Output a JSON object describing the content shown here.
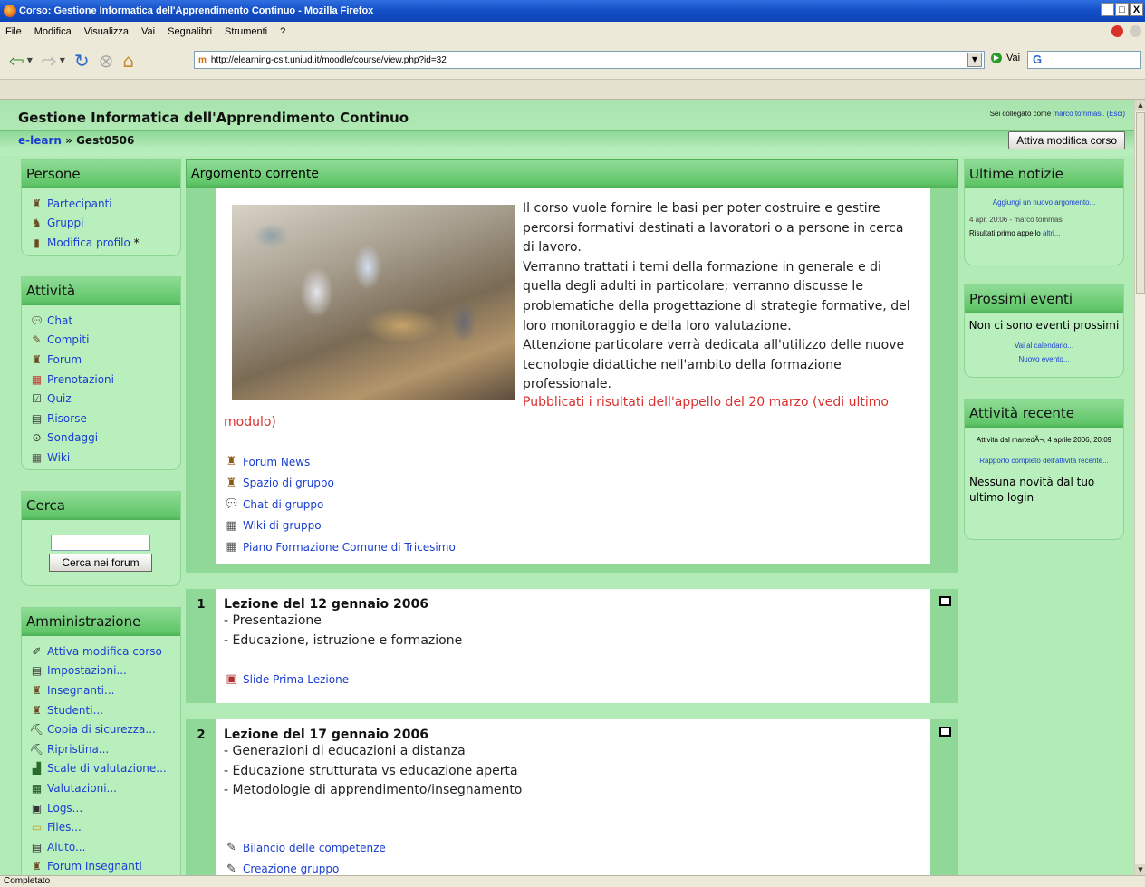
{
  "window": {
    "title": "Corso: Gestione Informatica dell'Apprendimento Continuo - Mozilla Firefox",
    "buttons": [
      "_",
      "□",
      "X"
    ]
  },
  "menu": [
    "File",
    "Modifica",
    "Visualizza",
    "Vai",
    "Segnalibri",
    "Strumenti",
    "?"
  ],
  "nav": {
    "url": "http://elearning-csit.uniud.it/moodle/course/view.php?id=32",
    "go_label": "Vai",
    "search_value": "G"
  },
  "status": "Completato",
  "page": {
    "course_title": "Gestione Informatica dell'Apprendimento Continuo",
    "login": {
      "prefix": "Sei collegato come",
      "user": "marco tommasi.",
      "logout": "(Esci)"
    },
    "breadcrumb": {
      "root": "e-learn",
      "sep": "»",
      "current": "Gest0506"
    },
    "edit_button": "Attiva modifica corso"
  },
  "persone": {
    "title": "Persone",
    "items": [
      {
        "label": "Partecipanti",
        "icon": "people-icon"
      },
      {
        "label": "Gruppi",
        "icon": "groups-icon"
      },
      {
        "label": "Modifica profilo",
        "suffix": "*",
        "icon": "profile-icon"
      }
    ]
  },
  "attivita": {
    "title": "Attività",
    "items": [
      {
        "label": "Chat",
        "icon": "chat-icon"
      },
      {
        "label": "Compiti",
        "icon": "assignment-icon"
      },
      {
        "label": "Forum",
        "icon": "forum-icon"
      },
      {
        "label": "Prenotazioni",
        "icon": "booking-icon"
      },
      {
        "label": "Quiz",
        "icon": "quiz-icon"
      },
      {
        "label": "Risorse",
        "icon": "resource-icon"
      },
      {
        "label": "Sondaggi",
        "icon": "survey-icon"
      },
      {
        "label": "Wiki",
        "icon": "wiki-icon"
      }
    ]
  },
  "cerca": {
    "title": "Cerca",
    "input_value": "",
    "button": "Cerca nei forum"
  },
  "amministrazione": {
    "title": "Amministrazione",
    "items": [
      {
        "label": "Attiva modifica corso",
        "icon": "edit-icon"
      },
      {
        "label": "Impostazioni...",
        "icon": "settings-icon"
      },
      {
        "label": "Insegnanti...",
        "icon": "teachers-icon"
      },
      {
        "label": "Studenti...",
        "icon": "students-icon"
      },
      {
        "label": "Copia di sicurezza...",
        "icon": "backup-icon"
      },
      {
        "label": "Ripristina...",
        "icon": "restore-icon"
      },
      {
        "label": "Scale di valutazione...",
        "icon": "scales-icon"
      },
      {
        "label": "Valutazioni...",
        "icon": "grades-icon"
      },
      {
        "label": "Logs...",
        "icon": "logs-icon"
      },
      {
        "label": "Files...",
        "icon": "folder-icon"
      },
      {
        "label": "Aiuto...",
        "icon": "help-icon"
      },
      {
        "label": "Forum Insegnanti",
        "icon": "forum-icon"
      }
    ]
  },
  "center": {
    "title": "Argomento corrente",
    "intro": "Il corso vuole fornire le basi per poter costruire e gestire percorsi formativi destinati a lavoratori o a persone in cerca di lavoro. Verranno trattati i temi della formazione in generale e di quella degli adulti in particolare; verranno discusse le problematiche della progettazione di strategie formative, del loro monitoraggio e della loro valutazione. Attenzione particolare verrà dedicata all'utilizzo delle nuove tecnologie didattiche nell'ambito della formazione professionale.",
    "intro_lines": [
      "Il corso vuole fornire le basi per poter costruire e gestire",
      "percorsi formativi destinati a lavoratori o a persone in cerca",
      "di lavoro.",
      "Verranno trattati i temi della formazione in generale e di",
      "quella degli adulti in particolare; verranno discusse le",
      "problematiche della progettazione di strategie formative, del",
      "loro monitoraggio e della loro valutazione.",
      "Attenzione particolare verrà dedicata all'utilizzo delle nuove",
      "tecnologie didattiche nell'ambito della formazione",
      "professionale."
    ],
    "news": "Pubblicati i risultati dell'appello del 20 marzo (vedi ultimo modulo)",
    "resources": [
      {
        "label": "Forum News",
        "icon": "forum-icon"
      },
      {
        "label": "Spazio di gruppo",
        "icon": "forum-icon"
      },
      {
        "label": "Chat di gruppo",
        "icon": "chat-icon"
      },
      {
        "label": "Wiki di gruppo",
        "icon": "wiki-icon"
      },
      {
        "label": "Piano Formazione Comune di Tricesimo",
        "icon": "wiki-icon"
      }
    ]
  },
  "sections": [
    {
      "num": "1",
      "title": "Lezione del 12 gennaio 2006",
      "lines": [
        "- Presentazione",
        "- Educazione, istruzione e formazione"
      ],
      "resources": [
        {
          "label": "Slide Prima Lezione",
          "icon": "slides-icon"
        }
      ]
    },
    {
      "num": "2",
      "title": "Lezione del 17 gennaio 2006",
      "lines": [
        "- Generazioni di educazioni a distanza",
        "- Educazione strutturata vs educazione aperta",
        "- Metodologie di apprendimento/insegnamento"
      ],
      "resources": [
        {
          "label": "Bilancio delle competenze",
          "icon": "assignment-icon"
        },
        {
          "label": "Creazione gruppo",
          "icon": "assignment-icon"
        }
      ]
    }
  ],
  "news_block": {
    "title": "Ultime notizie",
    "add_link": "Aggiungi un nuovo argomento...",
    "post_meta": "4 apr, 20:06 - marco tommasi",
    "post_title": "Risultati primo appello",
    "more": "altri..."
  },
  "events_block": {
    "title": "Prossimi eventi",
    "empty": "Non ci sono eventi prossimi",
    "calendar_link": "Vai al calendario...",
    "new_event": "Nuovo evento..."
  },
  "recent_block": {
    "title": "Attività recente",
    "since": "Attività dal martedÃ¬, 4 aprile 2006, 20:09",
    "full_report": "Rapporto completo dell'attività recente...",
    "none": "Nessuna novità dal tuo ultimo login"
  }
}
